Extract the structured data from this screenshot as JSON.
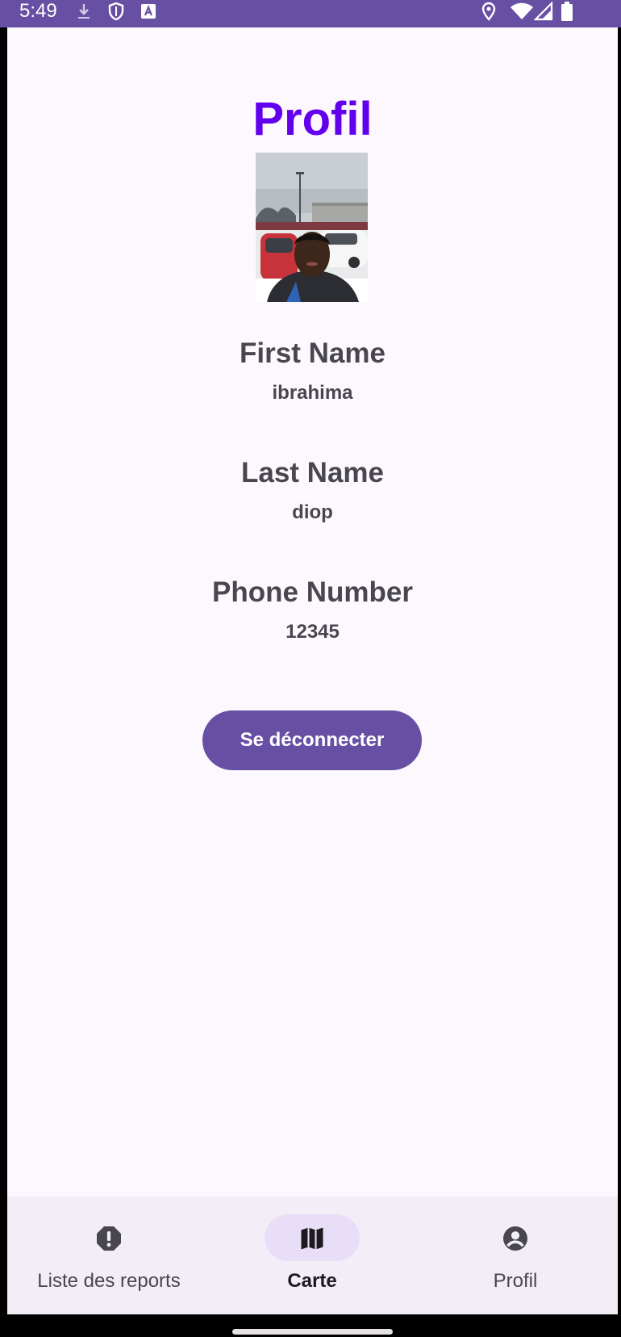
{
  "status_bar": {
    "time": "5:49",
    "icons": [
      "download-icon",
      "shield-icon",
      "text-a-icon",
      "location-icon",
      "wifi-icon",
      "signal-icon",
      "battery-icon"
    ]
  },
  "page": {
    "title": "Profil"
  },
  "profile": {
    "first_name_label": "First Name",
    "first_name": "ibrahima",
    "last_name_label": "Last Name",
    "last_name": "diop",
    "phone_label": "Phone Number",
    "phone": "12345"
  },
  "actions": {
    "logout_label": "Se déconnecter"
  },
  "bottom_nav": {
    "active_index": 1,
    "items": [
      {
        "label": "Liste des reports",
        "icon": "alert-octagon-icon"
      },
      {
        "label": "Carte",
        "icon": "map-icon"
      },
      {
        "label": "Profil",
        "icon": "account-circle-icon"
      }
    ]
  },
  "colors": {
    "accent": "#6750A4",
    "title": "#6200EE",
    "text": "#48464F",
    "background": "#FDF8FD",
    "nav_background": "#F3EDF7",
    "nav_indicator": "#E8DEF8"
  }
}
